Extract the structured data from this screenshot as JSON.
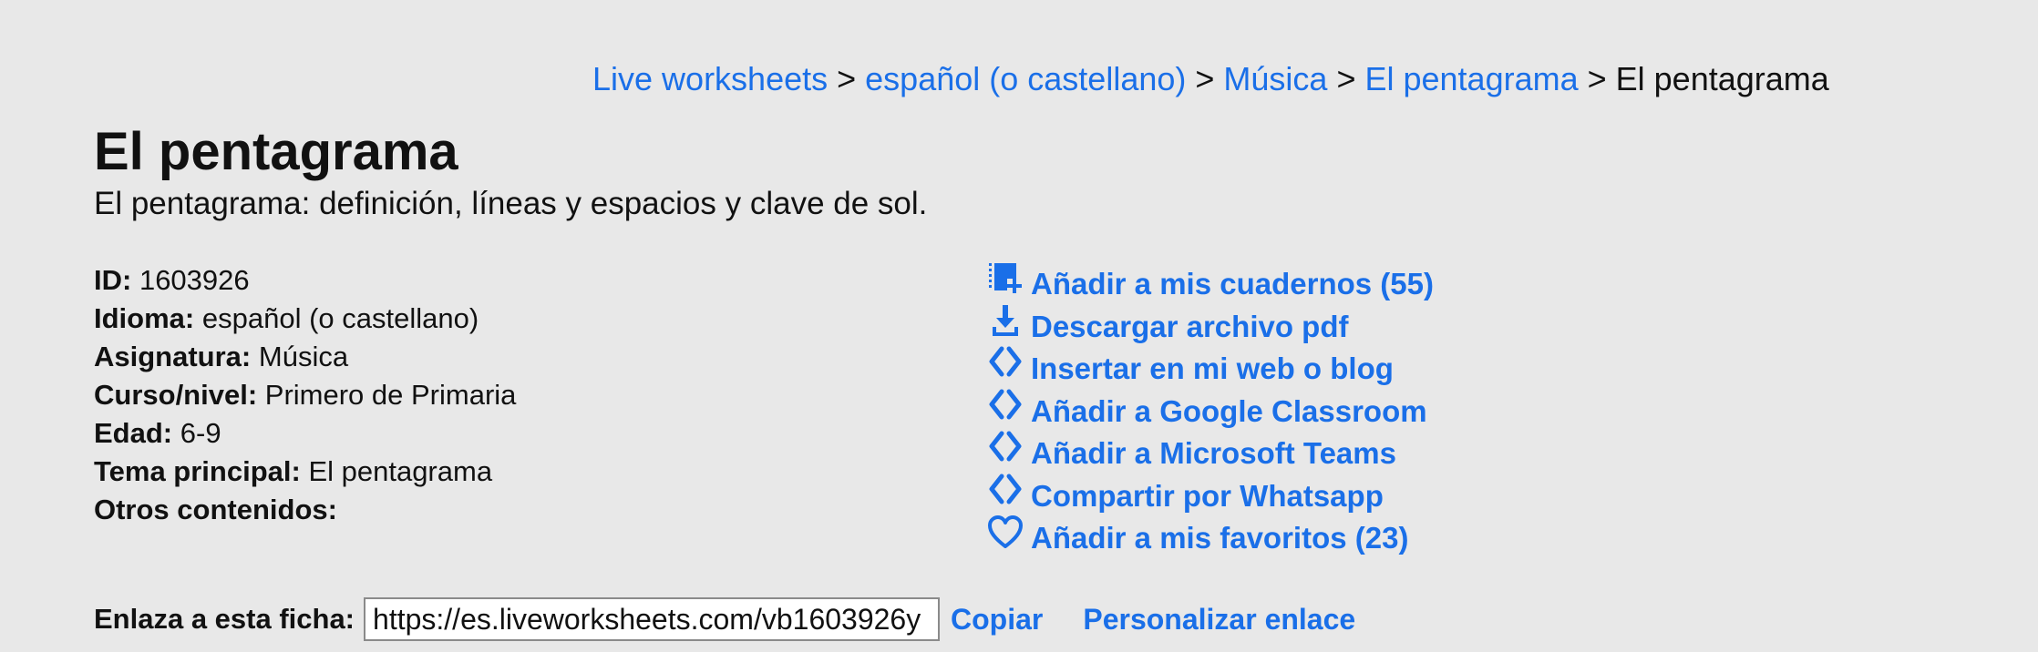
{
  "breadcrumb": {
    "items": [
      {
        "label": "Live worksheets"
      },
      {
        "label": "español (o castellano)"
      },
      {
        "label": "Música"
      },
      {
        "label": "El pentagrama"
      }
    ],
    "separator": ">",
    "current": "El pentagrama"
  },
  "worksheet": {
    "title": "El pentagrama",
    "description": "El pentagrama: definición, líneas y espacios y clave de sol."
  },
  "info": {
    "id": {
      "label": "ID:",
      "value": "1603926"
    },
    "language": {
      "label": "Idioma:",
      "value": "español (o castellano)"
    },
    "subject": {
      "label": "Asignatura:",
      "value": "Música"
    },
    "grade": {
      "label": "Curso/nivel:",
      "value": "Primero de Primaria"
    },
    "age": {
      "label": "Edad:",
      "value": "6-9"
    },
    "main_topic": {
      "label": "Tema principal:",
      "value": "El pentagrama"
    },
    "other_content": {
      "label": "Otros contenidos:",
      "value": ""
    }
  },
  "actions": [
    {
      "label": "Añadir a mis cuadernos (55)",
      "icon": "add-to-notebook-icon"
    },
    {
      "label": "Descargar archivo pdf",
      "icon": "download-icon"
    },
    {
      "label": "Insertar en mi web o blog",
      "icon": "embed-code-icon"
    },
    {
      "label": "Añadir a Google Classroom",
      "icon": "embed-code-icon"
    },
    {
      "label": "Añadir a Microsoft Teams",
      "icon": "embed-code-icon"
    },
    {
      "label": "Compartir por Whatsapp",
      "icon": "embed-code-icon"
    },
    {
      "label": "Añadir a mis favoritos (23)",
      "icon": "heart-icon"
    }
  ],
  "share_link": {
    "label": "Enlaza a esta ficha:",
    "value": "https://es.liveworksheets.com/vb1603926y",
    "copy_label": "Copiar",
    "personalize_label": "Personalizar enlace"
  },
  "colors": {
    "background": "#e8e8e8",
    "link": "#1a6fe8",
    "text": "#111111"
  }
}
